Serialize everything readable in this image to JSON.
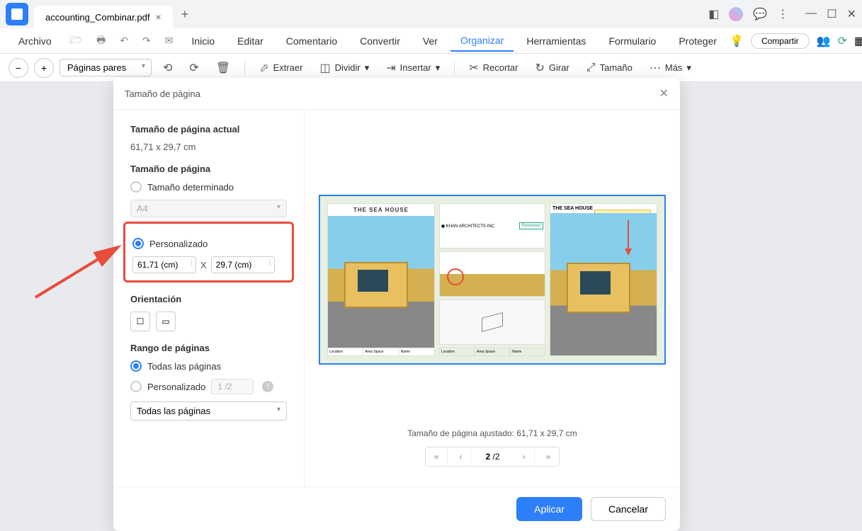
{
  "tab": {
    "title": "accounting_Combinar.pdf"
  },
  "menu": {
    "archivo": "Archivo",
    "items": [
      "Inicio",
      "Editar",
      "Comentario",
      "Convertir",
      "Ver",
      "Organizar",
      "Herramientas",
      "Formulario",
      "Proteger"
    ],
    "active": "Organizar",
    "share": "Compartir"
  },
  "toolbar": {
    "page_select": "Páginas pares",
    "extraer": "Extraer",
    "dividir": "Dividir",
    "insertar": "Insertar",
    "recortar": "Recortar",
    "girar": "Girar",
    "tamano": "Tamaño",
    "mas": "Más"
  },
  "dialog": {
    "title": "Tamaño de página",
    "current_label": "Tamaño de página actual",
    "current_value": "61,71 x 29,7 cm",
    "size_label": "Tamaño de página",
    "preset_radio": "Tamaño determinado",
    "preset_value": "A4",
    "custom_radio": "Personalizado",
    "width": "61,71 (cm)",
    "height": "29,7 (cm)",
    "x": "X",
    "orientation": "Orientación",
    "range_label": "Rango de páginas",
    "all_pages": "Todas las páginas",
    "custom_range": "Personalizado",
    "range_value": "1 /2",
    "range_select": "Todas las páginas",
    "adjusted": "Tamaño de página ajustado: 61,71 x 29,7 cm",
    "page_current": "2",
    "page_total": "/2",
    "apply": "Aplicar",
    "cancel": "Cancelar"
  },
  "preview": {
    "title1": "THE SEA HOUSE",
    "brand": "KHAN ARCHITECTS INC",
    "reviewed": "Reviewed",
    "title2": "THE SEA HOUSE"
  }
}
